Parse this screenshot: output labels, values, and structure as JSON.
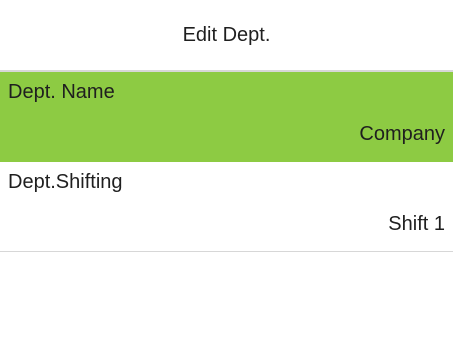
{
  "header": {
    "title": "Edit Dept."
  },
  "menu": {
    "items": [
      {
        "label": "Dept. Name",
        "value": "Company",
        "selected": true
      },
      {
        "label": "Dept.Shifting",
        "value": "Shift 1",
        "selected": false
      }
    ]
  },
  "colors": {
    "selected_background": "#8dcb43",
    "background": "#ffffff",
    "divider": "#d7d7d7",
    "text": "#1f1f1f"
  }
}
